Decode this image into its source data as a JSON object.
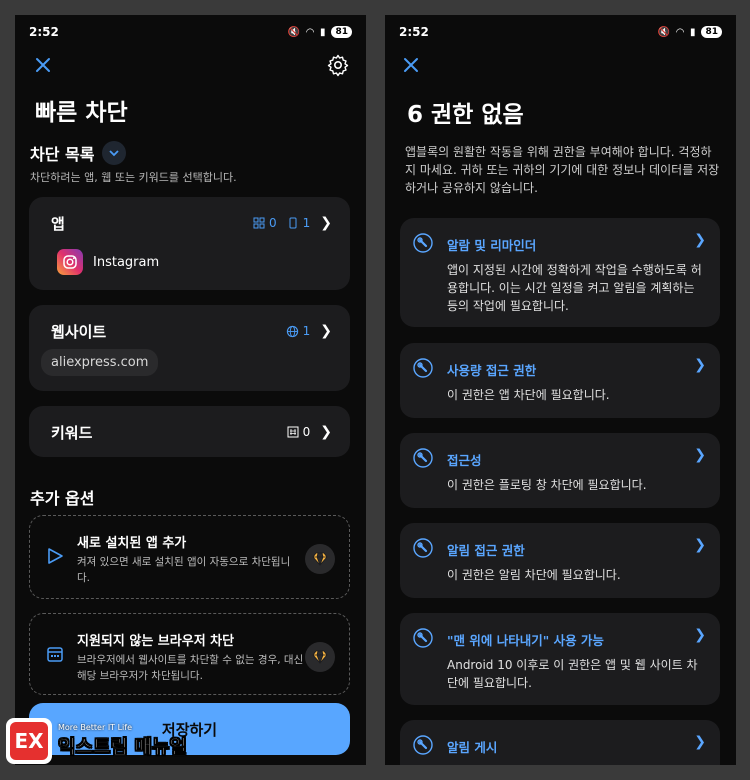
{
  "left": {
    "status": {
      "time": "2:52",
      "battery": "81"
    },
    "title": "빠른 차단",
    "block_list": {
      "heading": "차단 목록",
      "subtitle": "차단하려는 앱, 웹 또는 키워드를 선택합니다."
    },
    "apps": {
      "title": "앱",
      "count_a": "0",
      "count_b": "1",
      "item_label": "Instagram"
    },
    "websites": {
      "title": "웹사이트",
      "count": "1",
      "chip": "aliexpress.com"
    },
    "keywords": {
      "title": "키워드",
      "count": "0"
    },
    "extra": {
      "heading": "추가 옵션"
    },
    "opt1": {
      "title": "새로 설치된 앱 추가",
      "desc": "켜져 있으면 새로 설치된 앱이 자동으로 차단됩니다."
    },
    "opt2": {
      "title": "지원되지 않는 브라우저 차단",
      "desc": "브라우저에서 웹사이트를 차단할 수 없는 경우, 대신 해당 브라우저가 차단됩니다."
    },
    "save_label": "저장하기"
  },
  "right": {
    "status": {
      "time": "2:52",
      "battery": "81"
    },
    "title": "6 권한 없음",
    "intro": "앱블록의 원활한 작동을 위해 권한을 부여해야 합니다. 걱정하지 마세요. 귀하 또는 귀하의 기기에 대한 정보나 데이터를 저장하거나 공유하지 않습니다.",
    "permissions": [
      {
        "title": "알람 및 리마인더",
        "desc": "앱이 지정된 시간에 정확하게 작업을 수행하도록 허용합니다. 이는 시간 일정을 켜고 알림을 계획하는 등의 작업에 필요합니다."
      },
      {
        "title": "사용량 접근 권한",
        "desc": "이 권한은 앱 차단에 필요합니다."
      },
      {
        "title": "접근성",
        "desc": "이 권한은 플로팅 창 차단에 필요합니다."
      },
      {
        "title": "알림 접근 권한",
        "desc": "이 권한은 알림 차단에 필요합니다."
      },
      {
        "title": "\"맨 위에 나타내기\" 사용 가능",
        "desc": "Android 10 이후로 이 권한은 앱 및 웹 사이트 차단에 필요합니다."
      },
      {
        "title": "알림 게시",
        "desc": ""
      }
    ]
  },
  "watermark": {
    "small": "More Better IT Life",
    "big": "익스트림 매뉴얼",
    "mark": "EX"
  },
  "colors": {
    "accent": "#58a6ff",
    "background": "#0b0b0b",
    "card": "#1c1c1e"
  }
}
